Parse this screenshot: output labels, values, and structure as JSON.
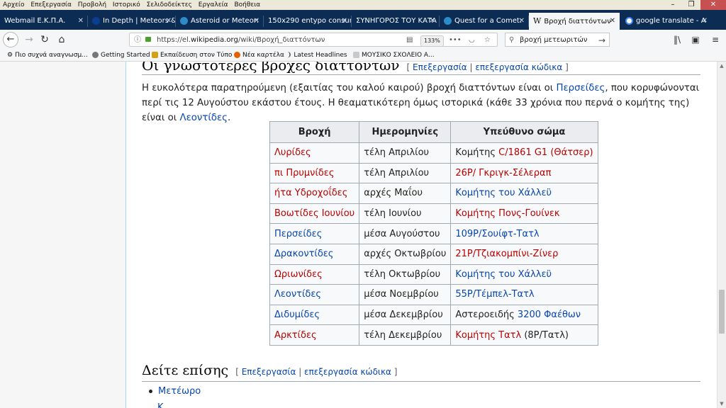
{
  "menu": [
    "Αρχείο",
    "Επεξεργασία",
    "Προβολή",
    "Ιστορικό",
    "Σελιδοδείκτες",
    "Εργαλεία",
    "Βοήθεια"
  ],
  "tabs": [
    {
      "label": "Webmail Ε.Κ.Π.Α.",
      "color": "#1b5fa8"
    },
    {
      "label": "In Depth | Meteors &",
      "color": "#0b3d91"
    },
    {
      "label": "Asteroid or Meteor:",
      "color": "#2e8bc9"
    },
    {
      "label": "150x290 entypo consum",
      "color": "#cccccc"
    },
    {
      "label": "ΣΥΝΗΓΟΡΟΣ ΤΟΥ ΚΑΤΑ",
      "color": "#cccccc"
    },
    {
      "label": "Quest for a Comet:",
      "color": "#2e8bc9"
    },
    {
      "label": "Βροχή διαττόντων",
      "color": "#ffffff"
    },
    {
      "label": "google translate - A",
      "color": "#4285f4"
    }
  ],
  "url": {
    "prefix": "https://el.",
    "host": "wikipedia.org",
    "path": "/wiki/Βροχή_διαττόντων",
    "zoom": "133%"
  },
  "search": {
    "value": "βροχή μετεωριτών"
  },
  "bookmarks": [
    "Πιο συχνά αναγνωσμ...",
    "Getting Started",
    "Εκπαίδευση στον Τύπο",
    "Νέα καρτέλα",
    "Latest Headlines",
    "ΜΟΥΣΙΚΟ ΣΧΟΛΕΙΟ Α..."
  ],
  "section1": {
    "title": "Οι γνωστότερες βροχές διαττόντων",
    "edit": "Επεξεργασία",
    "edit_code": "επεξεργασία κώδικα"
  },
  "paragraph": {
    "p1": "Η ευκολότερα παρατηρούμενη (εξαιτίας του καλού καιρού) βροχή διαττόντων είναι οι ",
    "l1": "Περσείδες",
    "p2": ", που κορυφώνονται περί τις 12 Αυγούστου εκάστου έτους. Η θεαματικότερη όμως ιστορικά (κάθε 33 χρόνια που περνά ο κομήτης της) είναι οι ",
    "l2": "Λεοντίδες",
    "p3": "."
  },
  "table": {
    "headers": [
      "Βροχή",
      "Ημερομηνίες",
      "Υπεύθυνο σώμα"
    ],
    "rows": [
      {
        "shower": "Λυρίδες",
        "shower_red": true,
        "dates": "τέλη Απριλίου",
        "pre": "Κομήτης ",
        "body": "C/1861 G1 (Θάτσερ)",
        "body_red": true,
        "post": ""
      },
      {
        "shower": "πι Πρυμνίδες",
        "shower_red": true,
        "dates": "τέλη Απριλίου",
        "pre": "",
        "body": "26P/ Γκριγκ-Σέλεραπ",
        "body_red": true,
        "post": ""
      },
      {
        "shower": "ήτα Υδροχοΐδες",
        "shower_red": true,
        "dates": "αρχές Μαΐου",
        "pre": "",
        "body": "Κομήτης του Χάλλεϋ",
        "body_red": false,
        "post": ""
      },
      {
        "shower": "Βοωτίδες Ιουνίου",
        "shower_red": true,
        "dates": "τέλη Ιουνίου",
        "pre": "",
        "body": "Κομήτης Πονς-Γουίνεκ",
        "body_red": true,
        "post": ""
      },
      {
        "shower": "Περσείδες",
        "shower_red": false,
        "dates": "μέσα Αυγούστου",
        "pre": "",
        "body": "109P/Σουίφτ-Τατλ",
        "body_red": false,
        "post": ""
      },
      {
        "shower": "Δρακοντίδες",
        "shower_red": false,
        "dates": "αρχές Οκτωβρίου",
        "pre": "",
        "body": "21P/Τζιακομπίνι-Ζίνερ",
        "body_red": true,
        "post": ""
      },
      {
        "shower": "Ωριωνίδες",
        "shower_red": true,
        "dates": "τέλη Οκτωβρίου",
        "pre": "",
        "body": "Κομήτης του Χάλλεϋ",
        "body_red": false,
        "post": ""
      },
      {
        "shower": "Λεοντίδες",
        "shower_red": false,
        "dates": "μέσα Νοεμβρίου",
        "pre": "",
        "body": "55P/Τέμπελ-Τατλ",
        "body_red": false,
        "post": ""
      },
      {
        "shower": "Διδυμίδες",
        "shower_red": false,
        "dates": "μέσα Δεκεμβρίου",
        "pre": "Αστεροειδής ",
        "body": "3200 Φαέθων",
        "body_red": false,
        "post": ""
      },
      {
        "shower": "Αρκτίδες",
        "shower_red": true,
        "dates": "τέλη Δεκεμβρίου",
        "pre": "",
        "body": "Κομήτης Τατλ",
        "body_red": true,
        "post": " (8P/Τατλ)"
      }
    ]
  },
  "section2": {
    "title": "Δείτε επίσης",
    "edit": "Επεξεργασία",
    "edit_code": "επεξεργασία κώδικα"
  },
  "seealso": {
    "item1": "Μετέωρο",
    "item2": "Κ..."
  },
  "colors": {
    "link": "#0645ad",
    "redlink": "#ba0000",
    "tabbar": "#0c2c54"
  }
}
